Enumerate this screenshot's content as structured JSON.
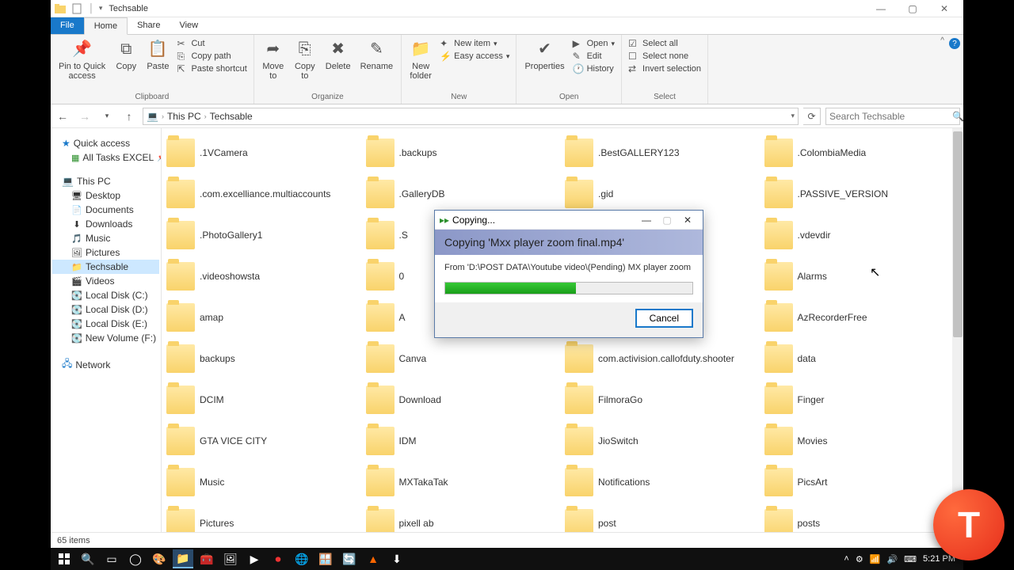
{
  "window": {
    "title": "Techsable",
    "tabs": {
      "file": "File",
      "home": "Home",
      "share": "Share",
      "view": "View"
    }
  },
  "ribbon": {
    "clipboard": {
      "label": "Clipboard",
      "pin": "Pin to Quick\naccess",
      "copy": "Copy",
      "paste": "Paste",
      "cut": "Cut",
      "copypath": "Copy path",
      "pasteshort": "Paste shortcut"
    },
    "organize": {
      "label": "Organize",
      "moveto": "Move\nto",
      "copyto": "Copy\nto",
      "delete": "Delete",
      "rename": "Rename"
    },
    "new": {
      "label": "New",
      "newfolder": "New\nfolder",
      "newitem": "New item",
      "easyaccess": "Easy access"
    },
    "open": {
      "label": "Open",
      "properties": "Properties",
      "open": "Open",
      "edit": "Edit",
      "history": "History"
    },
    "select": {
      "label": "Select",
      "all": "Select all",
      "none": "Select none",
      "invert": "Invert selection"
    }
  },
  "address": {
    "thispc": "This PC",
    "folder": "Techsable",
    "search_placeholder": "Search Techsable"
  },
  "nav": {
    "quick": "Quick access",
    "alltasks": "All Tasks EXCEL",
    "thispc": "This PC",
    "items": [
      "Desktop",
      "Documents",
      "Downloads",
      "Music",
      "Pictures",
      "Techsable",
      "Videos",
      "Local Disk (C:)",
      "Local Disk (D:)",
      "Local Disk (E:)",
      "New Volume (F:)"
    ],
    "network": "Network"
  },
  "folders": [
    ".1VCamera",
    ".backups",
    ".BestGALLERY123",
    ".ColombiaMedia",
    ".com.excelliance.multiaccounts",
    ".GalleryDB",
    ".gid",
    ".PASSIVE_VERSION",
    ".PhotoGallery1",
    ".S",
    "",
    ".vdevdir",
    ".videoshowsta",
    "0",
    "",
    "Alarms",
    "amap",
    "A",
    "",
    "AzRecorderFree",
    "backups",
    "Canva",
    "com.activision.callofduty.shooter",
    "data",
    "DCIM",
    "Download",
    "FilmoraGo",
    "Finger",
    "GTA VICE CITY",
    "IDM",
    "JioSwitch",
    "Movies",
    "Music",
    "MXTakaTak",
    "Notifications",
    "PicsArt",
    "Pictures",
    "pixell ab",
    "post",
    "posts"
  ],
  "status": {
    "items": "65 items"
  },
  "dialog": {
    "title": "Copying...",
    "heading": "Copying 'Mxx player zoom final.mp4'",
    "from": "From 'D:\\POST DATA\\Youtube video\\(Pending) MX player zoom hir",
    "progress_pct": 53,
    "cancel": "Cancel"
  },
  "taskbar": {
    "time": "5:21 PM"
  },
  "badge": "T"
}
